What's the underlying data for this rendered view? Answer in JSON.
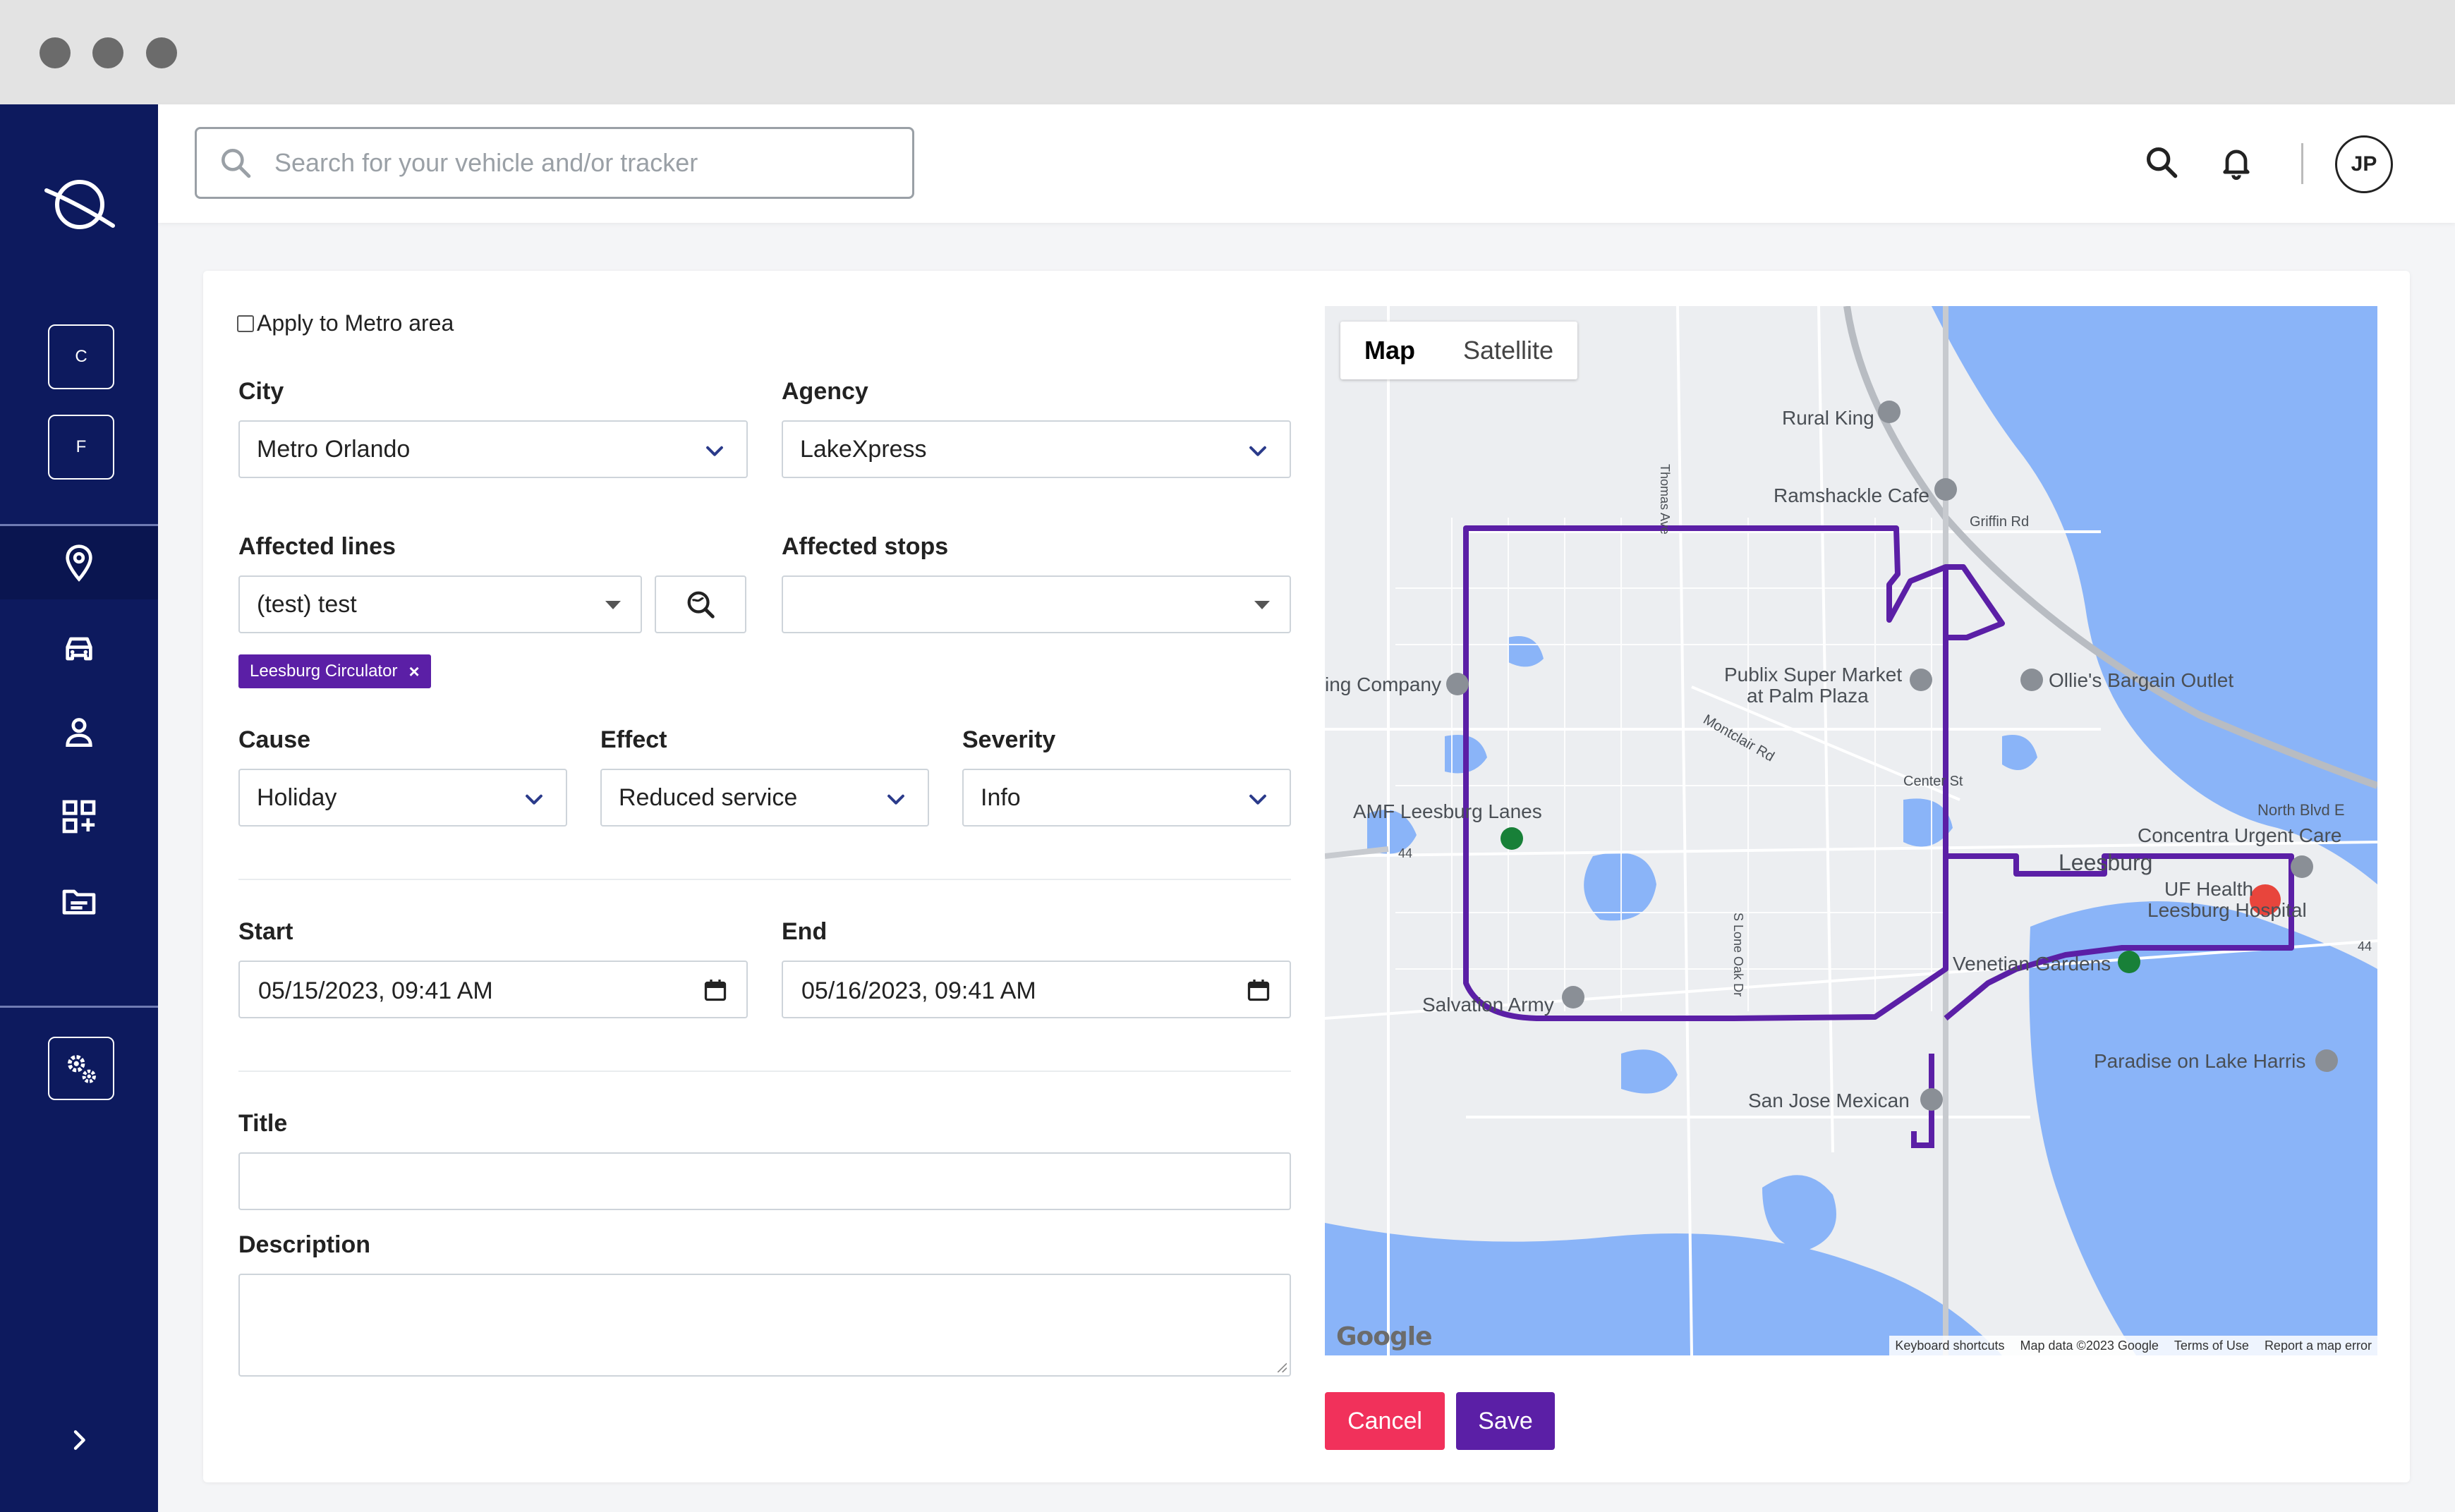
{
  "sidebar": {
    "buttons": [
      {
        "label": "C"
      },
      {
        "label": "F"
      }
    ],
    "nav": [
      "location-icon",
      "car-icon",
      "person-icon",
      "apps-add-icon",
      "folder-icon"
    ],
    "settings_icon": "gear-icon",
    "expand_icon": "chevron-right-icon"
  },
  "header": {
    "search_placeholder": "Search for your vehicle and/or tracker",
    "avatar_initials": "JP"
  },
  "form": {
    "apply_metro_label": "Apply to Metro area",
    "city": {
      "label": "City",
      "value": "Metro Orlando"
    },
    "agency": {
      "label": "Agency",
      "value": "LakeXpress"
    },
    "affected_lines": {
      "label": "Affected lines",
      "value": "(test) test",
      "tags": [
        "Leesburg Circulator"
      ],
      "tag_remove": "×"
    },
    "affected_stops": {
      "label": "Affected stops",
      "value": ""
    },
    "cause": {
      "label": "Cause",
      "value": "Holiday"
    },
    "effect": {
      "label": "Effect",
      "value": "Reduced service"
    },
    "severity": {
      "label": "Severity",
      "value": "Info"
    },
    "start": {
      "label": "Start",
      "value": "05/15/2023, 09:41 AM"
    },
    "end": {
      "label": "End",
      "value": "05/16/2023, 09:41 AM"
    },
    "title": {
      "label": "Title",
      "value": ""
    },
    "description": {
      "label": "Description",
      "value": ""
    }
  },
  "map": {
    "tabs": [
      "Map",
      "Satellite"
    ],
    "route_color": "#5b1fa6",
    "places": {
      "rural_king": "Rural King",
      "ramshackle": "Ramshackle Cafe",
      "griffin_rd": "Griffin Rd",
      "publix": "Publix Super Market",
      "publix2": "at Palm Plaza",
      "ollies": "Ollie's Bargain Outlet",
      "ing_company": "ing Company",
      "montclair": "Montclair Rd",
      "center_st": "Center St",
      "north_blvd": "North Blvd E",
      "amf": "AMF Leesburg Lanes",
      "concentra": "Concentra Urgent Care",
      "leesburg": "Leesburg",
      "uf_health": "UF Health",
      "uf_health2": "Leesburg Hospital",
      "venetian": "Venetian Gardens",
      "salvation": "Salvation Army",
      "paradise": "Paradise on Lake Harris",
      "san_jose": "San Jose Mexican",
      "thomas_ave": "Thomas Ave",
      "lone_oak": "S Lone Oak Dr",
      "route_44a": "44",
      "route_44b": "44"
    },
    "google_logo": "Google",
    "attribution": [
      "Keyboard shortcuts",
      "Map data ©2023 Google",
      "Terms of Use",
      "Report a map error"
    ]
  },
  "actions": {
    "cancel": "Cancel",
    "save": "Save"
  },
  "colors": {
    "sidebar": "#0d1a5e",
    "cancel": "#f1315b",
    "save": "#5b1fa6",
    "tag": "#5b1fa6"
  }
}
